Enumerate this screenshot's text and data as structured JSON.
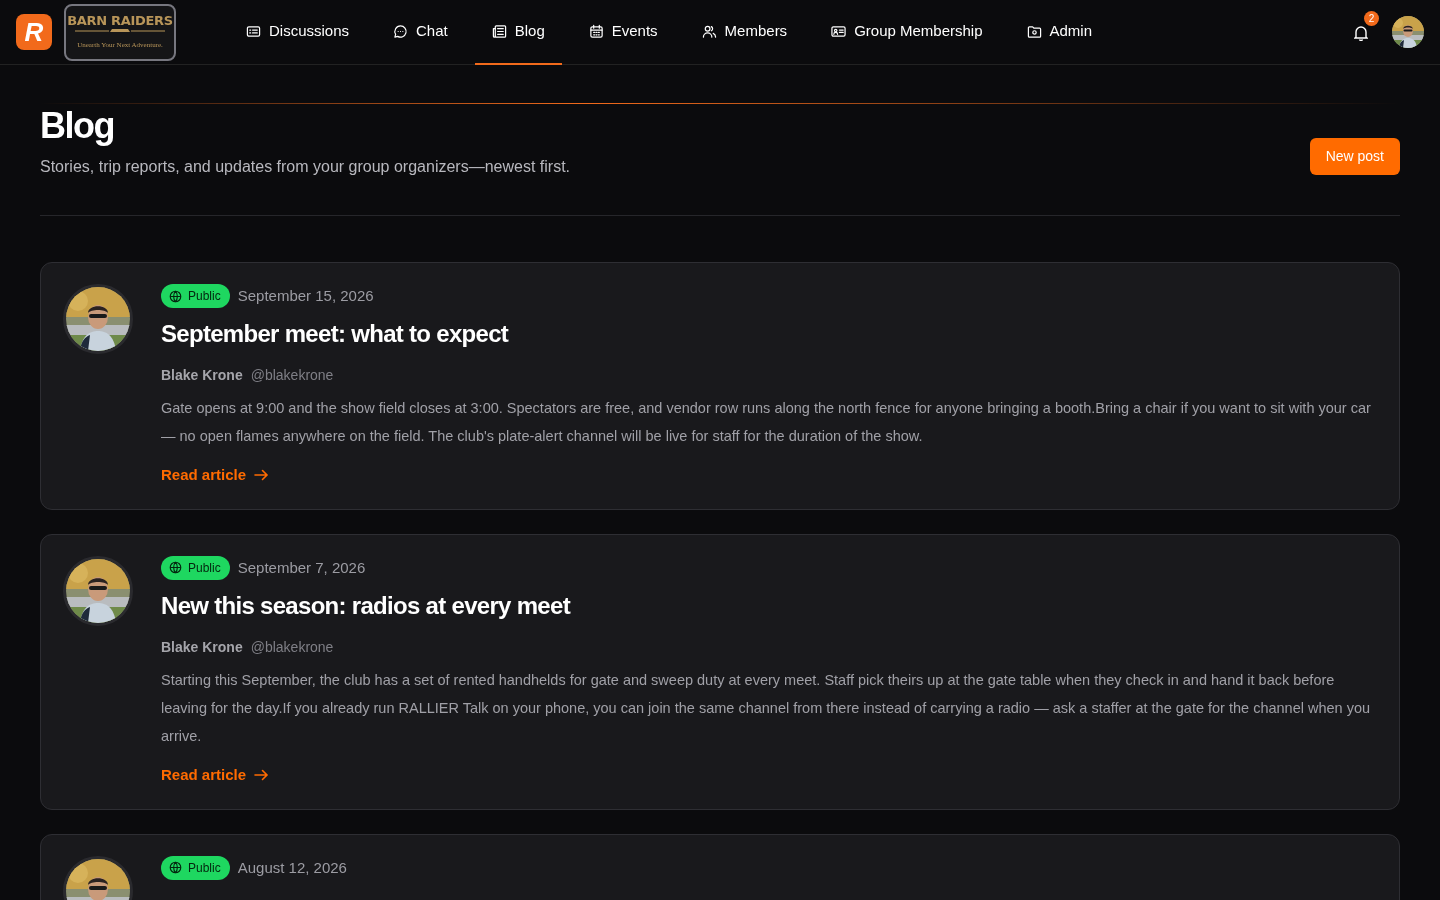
{
  "brand": {
    "mark": "R",
    "name": "BARN RAIDERS",
    "tagline": "Unearth Your Next Adventure."
  },
  "nav": [
    {
      "label": "Discussions",
      "selected": false
    },
    {
      "label": "Chat",
      "selected": false
    },
    {
      "label": "Blog",
      "selected": true
    },
    {
      "label": "Events",
      "selected": false
    },
    {
      "label": "Members",
      "selected": false
    },
    {
      "label": "Group Membership",
      "selected": false
    },
    {
      "label": "Admin",
      "selected": false
    }
  ],
  "notifications": {
    "count": "2"
  },
  "header": {
    "title": "Blog",
    "subtitle": "Stories, trip reports, and updates from your group organizers—newest first.",
    "button": "New post"
  },
  "posts": [
    {
      "visibility": "Public",
      "date": "September 15, 2026",
      "title": "September meet: what to expect",
      "author": "Blake Krone",
      "handle": "@blakekrone",
      "body": "Gate opens at 9:00 and the show field closes at 3:00. Spectators are free, and vendor row runs along the north fence for anyone bringing a booth.Bring a chair if you want to sit with your car — no open flames anywhere on the field. The club's plate-alert channel will be live for staff for the duration of the show.",
      "link": "Read article"
    },
    {
      "visibility": "Public",
      "date": "September 7, 2026",
      "title": "New this season: radios at every meet",
      "author": "Blake Krone",
      "handle": "@blakekrone",
      "body": "Starting this September, the club has a set of rented handhelds for gate and sweep duty at every meet. Staff pick theirs up at the gate table when they check in and hand it back before leaving for the day.If you already run RALLIER Talk on your phone, you can join the same channel from there instead of carrying a radio — ask a staffer at the gate for the channel when you arrive.",
      "link": "Read article"
    },
    {
      "visibility": "Public",
      "date": "August 12, 2026"
    }
  ]
}
